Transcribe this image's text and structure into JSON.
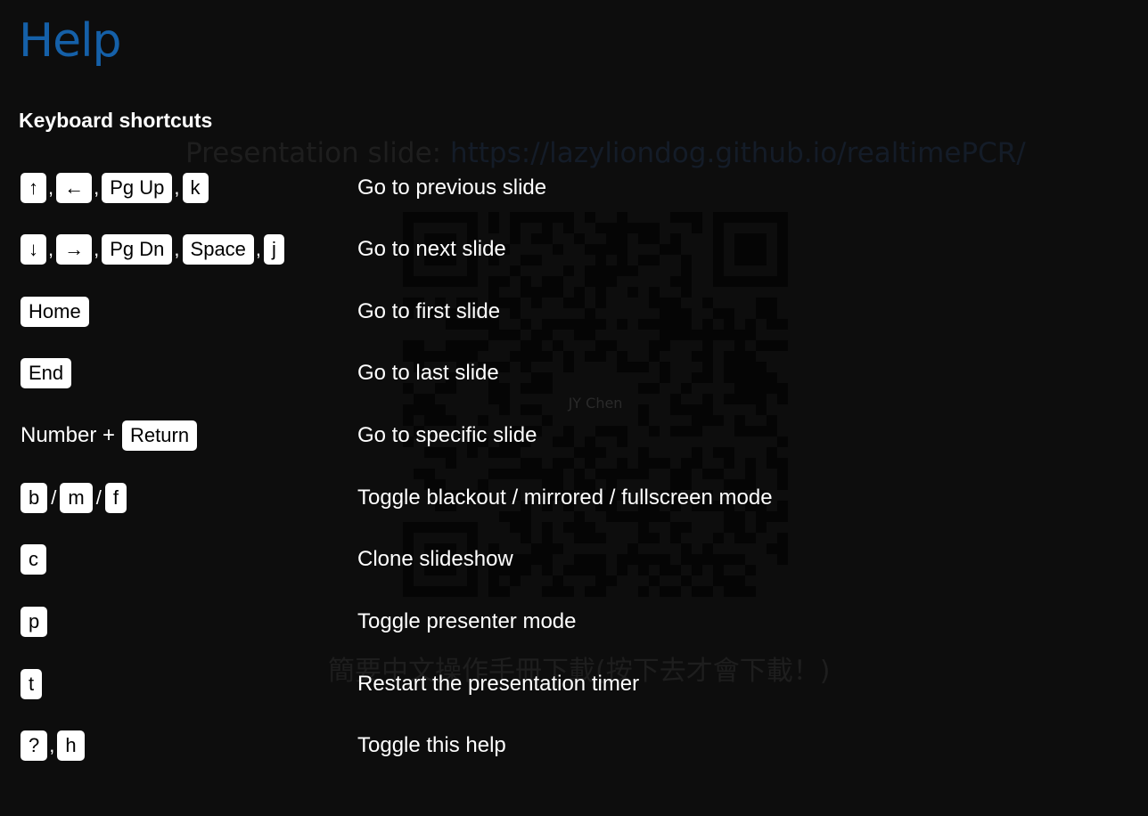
{
  "background_slide": {
    "caption_prefix": "Presentation slide: ",
    "caption_url": "https://lazyliondog.github.io/realtimePCR/",
    "qr_label": "JY Chen",
    "download_text": "簡要中文操作手冊下載(按下去才會下載！)"
  },
  "help": {
    "title": "Help",
    "subtitle": "Keyboard shortcuts",
    "shortcuts": [
      {
        "keys": [
          "↑",
          "←",
          "Pg Up",
          "k"
        ],
        "description": "Go to previous slide"
      },
      {
        "keys": [
          "↓",
          "→",
          "Pg Dn",
          "Space",
          "j"
        ],
        "description": "Go to next slide"
      },
      {
        "keys": [
          "Home"
        ],
        "description": "Go to first slide"
      },
      {
        "keys": [
          "End"
        ],
        "description": "Go to last slide"
      },
      {
        "prefix": "Number +",
        "keys": [
          "Return"
        ],
        "description": "Go to specific slide"
      },
      {
        "keys": [
          "b",
          "m",
          "f"
        ],
        "separator": "/",
        "description": "Toggle blackout / mirrored / fullscreen mode"
      },
      {
        "keys": [
          "c"
        ],
        "description": "Clone slideshow"
      },
      {
        "keys": [
          "p"
        ],
        "description": "Toggle presenter mode"
      },
      {
        "keys": [
          "t"
        ],
        "description": "Restart the presentation timer"
      },
      {
        "keys": [
          "?",
          "h"
        ],
        "description": "Toggle this help"
      }
    ]
  },
  "colors": {
    "background": "#0d0d0d",
    "title": "#1560a8",
    "key_bg": "#ffffff",
    "key_text": "#000000"
  }
}
